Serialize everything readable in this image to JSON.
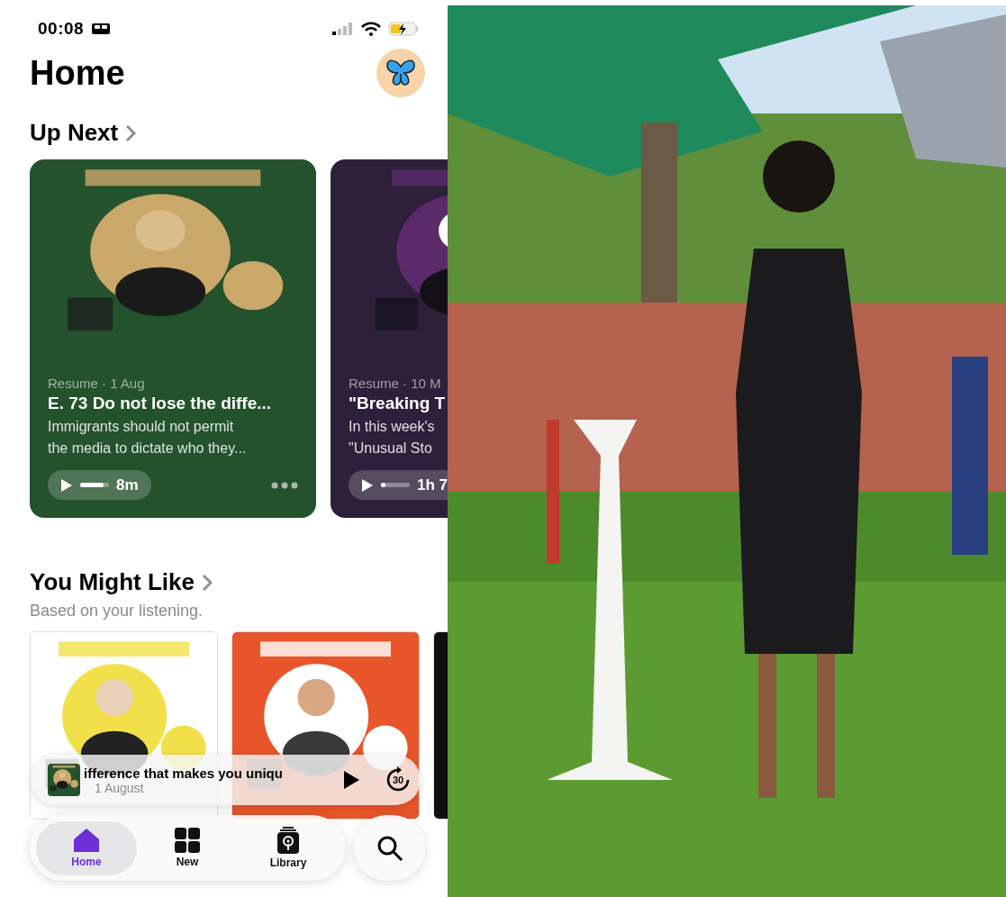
{
  "status_bar": {
    "time": "00:08"
  },
  "header": {
    "title": "Home"
  },
  "up_next": {
    "heading": "Up Next",
    "cards": [
      {
        "meta": "Resume · 1 Aug",
        "title": "E. 73 Do not lose the diffe...",
        "description": "Immigrants should not permit\nthe media to dictate who they...",
        "level": 0.8,
        "duration": "8m",
        "color": "#24522c",
        "menu": true
      },
      {
        "meta": "Resume · 10 M",
        "title": "\"Breaking T",
        "description": "In this week's\n\"Unusual Sto",
        "level": 0.15,
        "duration": "1h 7",
        "color": "#2e1f3a"
      }
    ]
  },
  "you_might_like": {
    "heading": "You Might Like",
    "subtitle": "Based on your listening."
  },
  "mini_player": {
    "title": "ifference that makes you uniqu",
    "date": "1 August",
    "skip": "30"
  },
  "tab_bar": {
    "tabs": [
      {
        "label": "Home",
        "selected": true
      },
      {
        "label": "New",
        "selected": false
      },
      {
        "label": "Library",
        "selected": false
      }
    ]
  }
}
